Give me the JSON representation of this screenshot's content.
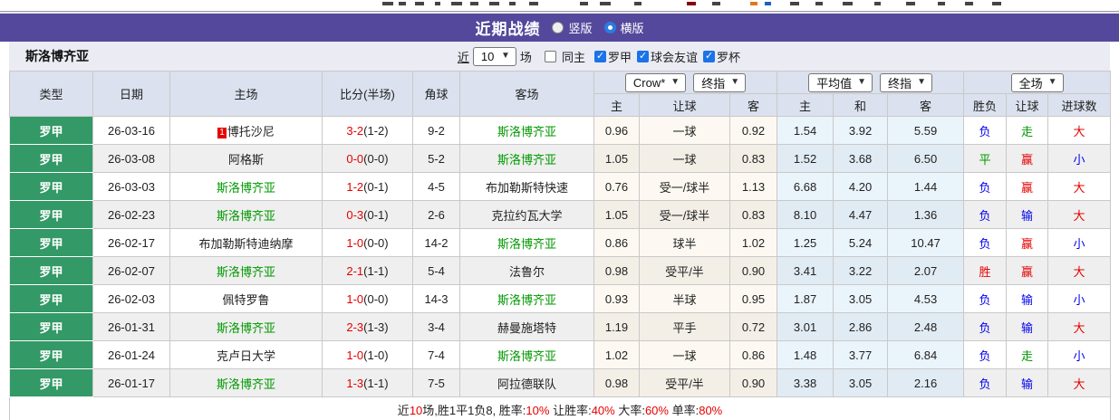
{
  "colors": {
    "accent_purple": "#54489c",
    "league_badge_green": "#339966",
    "team_highlight_green": "#009900",
    "result_red": "#e60000",
    "result_blue": "#0000ee",
    "result_green": "#009900"
  },
  "title_bar": {
    "title": "近期战绩",
    "radio_vertical": "竖版",
    "radio_horizontal": "横版",
    "selected": "横版"
  },
  "filter": {
    "team": "斯洛博齐亚",
    "near_label": "近",
    "match_count": "10",
    "matches_label": "场",
    "checkboxes": [
      {
        "label": "同主",
        "checked": false
      },
      {
        "label": "罗甲",
        "checked": true
      },
      {
        "label": "球会友谊",
        "checked": true
      },
      {
        "label": "罗杯",
        "checked": true
      }
    ]
  },
  "table": {
    "selects": {
      "bookmaker": "Crow*",
      "bookmaker_stage": "终指",
      "average": "平均值",
      "average_stage": "终指",
      "scope": "全场"
    },
    "headers": {
      "type": "类型",
      "date": "日期",
      "home": "主场",
      "score": "比分(半场)",
      "corner": "角球",
      "away": "客场",
      "odds_home": "主",
      "odds_line": "让球",
      "odds_away": "客",
      "avg_home": "主",
      "avg_draw": "和",
      "avg_away": "客",
      "result": "胜负",
      "handicap": "让球",
      "goals": "进球数"
    },
    "rows": [
      {
        "league": "罗甲",
        "date": "26-03-16",
        "home": "博托沙尼",
        "home_rank": "1",
        "home_hl": false,
        "score": "3-2",
        "half": "(1-2)",
        "corner": "9-2",
        "away": "斯洛博齐亚",
        "away_hl": true,
        "odds": [
          "0.96",
          "一球",
          "0.92"
        ],
        "avg": [
          "1.54",
          "3.92",
          "5.59"
        ],
        "results": [
          "负",
          "走",
          "大"
        ]
      },
      {
        "league": "罗甲",
        "date": "26-03-08",
        "home": "阿格斯",
        "home_rank": "",
        "home_hl": false,
        "score": "0-0",
        "half": "(0-0)",
        "corner": "5-2",
        "away": "斯洛博齐亚",
        "away_hl": true,
        "odds": [
          "1.05",
          "一球",
          "0.83"
        ],
        "avg": [
          "1.52",
          "3.68",
          "6.50"
        ],
        "results": [
          "平",
          "赢",
          "小"
        ]
      },
      {
        "league": "罗甲",
        "date": "26-03-03",
        "home": "斯洛博齐亚",
        "home_rank": "",
        "home_hl": true,
        "score": "1-2",
        "half": "(0-1)",
        "corner": "4-5",
        "away": "布加勒斯特快速",
        "away_hl": false,
        "odds": [
          "0.76",
          "受一/球半",
          "1.13"
        ],
        "avg": [
          "6.68",
          "4.20",
          "1.44"
        ],
        "results": [
          "负",
          "赢",
          "大"
        ]
      },
      {
        "league": "罗甲",
        "date": "26-02-23",
        "home": "斯洛博齐亚",
        "home_rank": "",
        "home_hl": true,
        "score": "0-3",
        "half": "(0-1)",
        "corner": "2-6",
        "away": "克拉约瓦大学",
        "away_hl": false,
        "odds": [
          "1.05",
          "受一/球半",
          "0.83"
        ],
        "avg": [
          "8.10",
          "4.47",
          "1.36"
        ],
        "results": [
          "负",
          "输",
          "大"
        ]
      },
      {
        "league": "罗甲",
        "date": "26-02-17",
        "home": "布加勒斯特迪纳摩",
        "home_rank": "",
        "home_hl": false,
        "score": "1-0",
        "half": "(0-0)",
        "corner": "14-2",
        "away": "斯洛博齐亚",
        "away_hl": true,
        "odds": [
          "0.86",
          "球半",
          "1.02"
        ],
        "avg": [
          "1.25",
          "5.24",
          "10.47"
        ],
        "results": [
          "负",
          "赢",
          "小"
        ]
      },
      {
        "league": "罗甲",
        "date": "26-02-07",
        "home": "斯洛博齐亚",
        "home_rank": "",
        "home_hl": true,
        "score": "2-1",
        "half": "(1-1)",
        "corner": "5-4",
        "away": "法鲁尔",
        "away_hl": false,
        "odds": [
          "0.98",
          "受平/半",
          "0.90"
        ],
        "avg": [
          "3.41",
          "3.22",
          "2.07"
        ],
        "results": [
          "胜",
          "赢",
          "大"
        ]
      },
      {
        "league": "罗甲",
        "date": "26-02-03",
        "home": "佩特罗鲁",
        "home_rank": "",
        "home_hl": false,
        "score": "1-0",
        "half": "(0-0)",
        "corner": "14-3",
        "away": "斯洛博齐亚",
        "away_hl": true,
        "odds": [
          "0.93",
          "半球",
          "0.95"
        ],
        "avg": [
          "1.87",
          "3.05",
          "4.53"
        ],
        "results": [
          "负",
          "输",
          "小"
        ]
      },
      {
        "league": "罗甲",
        "date": "26-01-31",
        "home": "斯洛博齐亚",
        "home_rank": "",
        "home_hl": true,
        "score": "2-3",
        "half": "(1-3)",
        "corner": "3-4",
        "away": "赫曼施塔特",
        "away_hl": false,
        "odds": [
          "1.19",
          "平手",
          "0.72"
        ],
        "avg": [
          "3.01",
          "2.86",
          "2.48"
        ],
        "results": [
          "负",
          "输",
          "大"
        ]
      },
      {
        "league": "罗甲",
        "date": "26-01-24",
        "home": "克卢日大学",
        "home_rank": "",
        "home_hl": false,
        "score": "1-0",
        "half": "(1-0)",
        "corner": "7-4",
        "away": "斯洛博齐亚",
        "away_hl": true,
        "odds": [
          "1.02",
          "一球",
          "0.86"
        ],
        "avg": [
          "1.48",
          "3.77",
          "6.84"
        ],
        "results": [
          "负",
          "走",
          "小"
        ]
      },
      {
        "league": "罗甲",
        "date": "26-01-17",
        "home": "斯洛博齐亚",
        "home_rank": "",
        "home_hl": true,
        "score": "1-3",
        "half": "(1-1)",
        "corner": "7-5",
        "away": "阿拉德联队",
        "away_hl": false,
        "odds": [
          "0.98",
          "受平/半",
          "0.90"
        ],
        "avg": [
          "3.38",
          "3.05",
          "2.16"
        ],
        "results": [
          "负",
          "输",
          "大"
        ]
      }
    ],
    "result_colors": {
      "胜": "#e60000",
      "平": "#009900",
      "负": "#0000ee",
      "赢": "#e60000",
      "输": "#0000ee",
      "走": "#009900",
      "大": "#e60000",
      "小": "#0000ee"
    }
  },
  "footer": {
    "segments": [
      {
        "text": "近",
        "red": false
      },
      {
        "text": "10",
        "red": true
      },
      {
        "text": "场,胜1平1负8, 胜率:",
        "red": false
      },
      {
        "text": "10%",
        "red": true
      },
      {
        "text": " 让胜率:",
        "red": false
      },
      {
        "text": "40%",
        "red": true
      },
      {
        "text": " 大率:",
        "red": false
      },
      {
        "text": "60%",
        "red": true
      },
      {
        "text": " 单率:",
        "red": false
      },
      {
        "text": "80%",
        "red": true
      }
    ]
  }
}
